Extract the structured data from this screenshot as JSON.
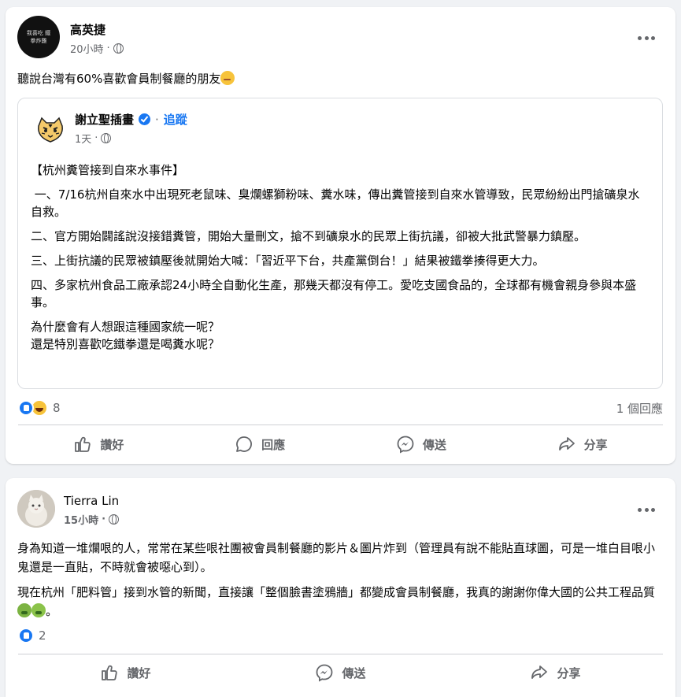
{
  "post1": {
    "author": "高英捷",
    "avatar_text": "我喜吃 鐵拳炸雞",
    "time": "20小時",
    "dot": "·",
    "text": "聽說台灣有60%喜歡會員制餐廳的朋友",
    "shared": {
      "author": "謝立聖插畫",
      "follow_label": "追蹤",
      "dot": "·",
      "time": "1天",
      "paragraphs": [
        "【杭州糞管接到自來水事件】",
        " 一、7/16杭州自來水中出現死老鼠味、臭爛螺獅粉味、糞水味，傳出糞管接到自來水管導致，民眾紛紛出門搶礦泉水自救。",
        "二、官方開始闢謠說沒接錯糞管，開始大量刪文，搶不到礦泉水的民眾上街抗議，卻被大批武警暴力鎮壓。",
        "三、上街抗議的民眾被鎮壓後就開始大喊：「習近平下台，共產黨倒台！」結果被鐵拳揍得更大力。",
        "四、多家杭州食品工廠承認24小時全自動化生產，那幾天都沒有停工。愛吃支國食品的，全球都有機會親身參與本盛事。"
      ],
      "closing_1": "為什麼會有人想跟這種國家統一呢？",
      "closing_2": "還是特別喜歡吃鐵拳還是喝糞水呢？"
    },
    "reaction_count": "8",
    "comment_count": "1 個回應",
    "actions": {
      "like": "讚好",
      "comment": "回應",
      "send": "傳送",
      "share": "分享"
    }
  },
  "post2": {
    "author": "Tierra Lin",
    "time": "15小時",
    "dot": "·",
    "paragraph_1": "身為知道一堆爛哏的人，常常在某些哏社團被會員制餐廳的影片＆圖片炸到（管理員有說不能貼直球圖，可是一堆白目哏小鬼還是一直貼，不時就會被噁心到）。",
    "paragraph_2": "現在杭州「肥料管」接到水管的新聞，直接讓「整個臉書塗鴉牆」都變成會員制餐廳，我真的謝謝你偉大國的公共工程品質",
    "paragraph_2_end": "。",
    "reaction_count": "2",
    "actions": {
      "like": "讚好",
      "send": "傳送",
      "share": "分享"
    }
  },
  "colors": {
    "accent": "#1877f2",
    "secondary_text": "#65676b",
    "background": "#f0f2f5"
  }
}
